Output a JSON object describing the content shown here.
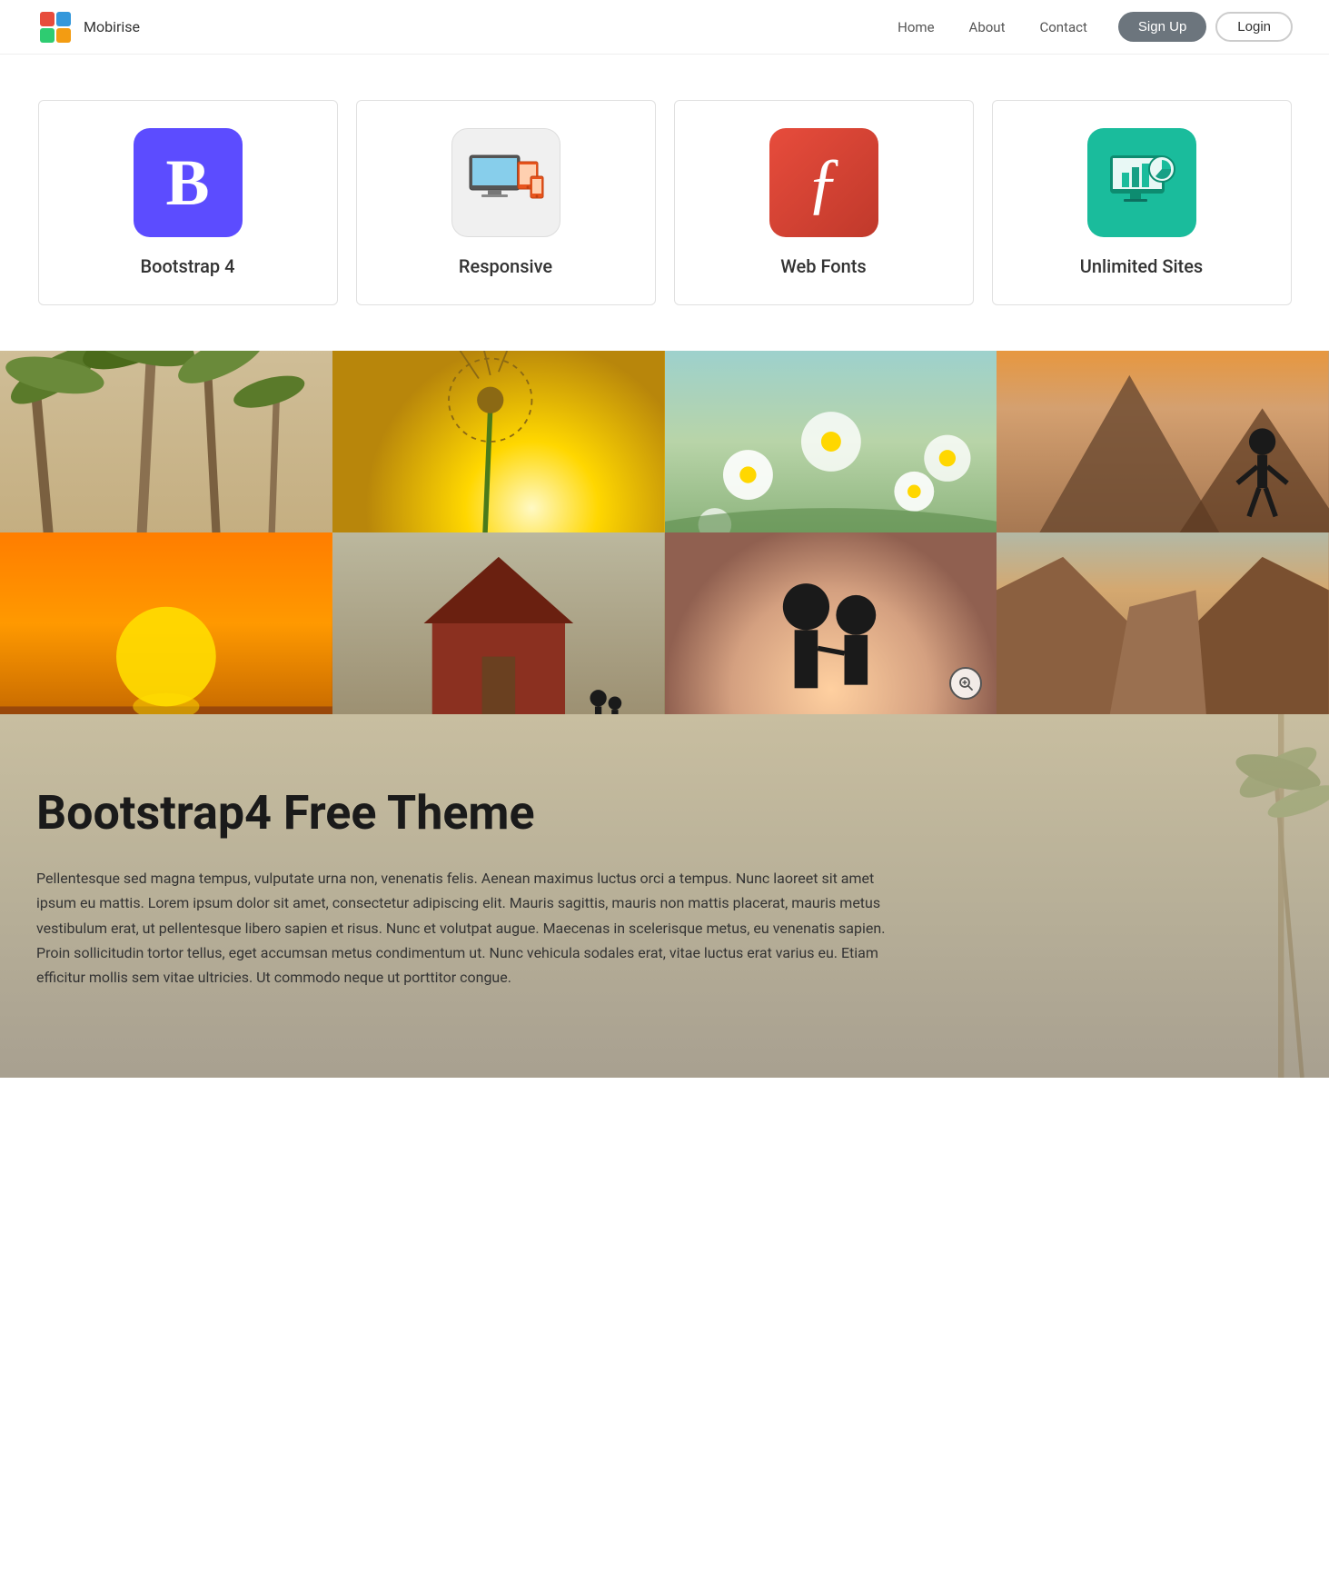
{
  "nav": {
    "brand": "Mobirise",
    "links": [
      "Home",
      "About",
      "Contact"
    ],
    "signup_label": "Sign Up",
    "login_label": "Login"
  },
  "features": {
    "cards": [
      {
        "id": "bootstrap",
        "label": "Bootstrap 4",
        "icon_text": "B",
        "icon_color": "#5c4cff"
      },
      {
        "id": "responsive",
        "label": "Responsive",
        "icon_text": "",
        "icon_color": "#f5f5f5"
      },
      {
        "id": "webfonts",
        "label": "Web Fonts",
        "icon_text": "ƒ",
        "icon_color": "#e74c3c"
      },
      {
        "id": "unlimited",
        "label": "Unlimited Sites",
        "icon_text": "",
        "icon_color": "#1abc9c"
      }
    ]
  },
  "gallery": {
    "zoom_icon": "⊕",
    "cells": [
      {
        "id": "cell-1",
        "class": "photo-palms"
      },
      {
        "id": "cell-2",
        "class": "photo-dandelion"
      },
      {
        "id": "cell-3",
        "class": "photo-flowers"
      },
      {
        "id": "cell-4",
        "class": "photo-person-mountain"
      },
      {
        "id": "cell-5",
        "class": "photo-sunset"
      },
      {
        "id": "cell-6",
        "class": "photo-farm"
      },
      {
        "id": "cell-7",
        "class": "photo-couple"
      },
      {
        "id": "cell-8",
        "class": "photo-rocks"
      }
    ]
  },
  "content": {
    "heading": "Bootstrap4 Free Theme",
    "body": "Pellentesque sed magna tempus, vulputate urna non, venenatis felis. Aenean maximus luctus orci a tempus. Nunc laoreet sit amet ipsum eu mattis. Lorem ipsum dolor sit amet, consectetur adipiscing elit. Mauris sagittis, mauris non mattis placerat, mauris metus vestibulum erat, ut pellentesque libero sapien et risus. Nunc et volutpat augue. Maecenas in scelerisque metus, eu venenatis sapien. Proin sollicitudin tortor tellus, eget accumsan metus condimentum ut. Nunc vehicula sodales erat, vitae luctus erat varius eu. Etiam efficitur mollis sem vitae ultricies. Ut commodo neque ut porttitor congue."
  }
}
